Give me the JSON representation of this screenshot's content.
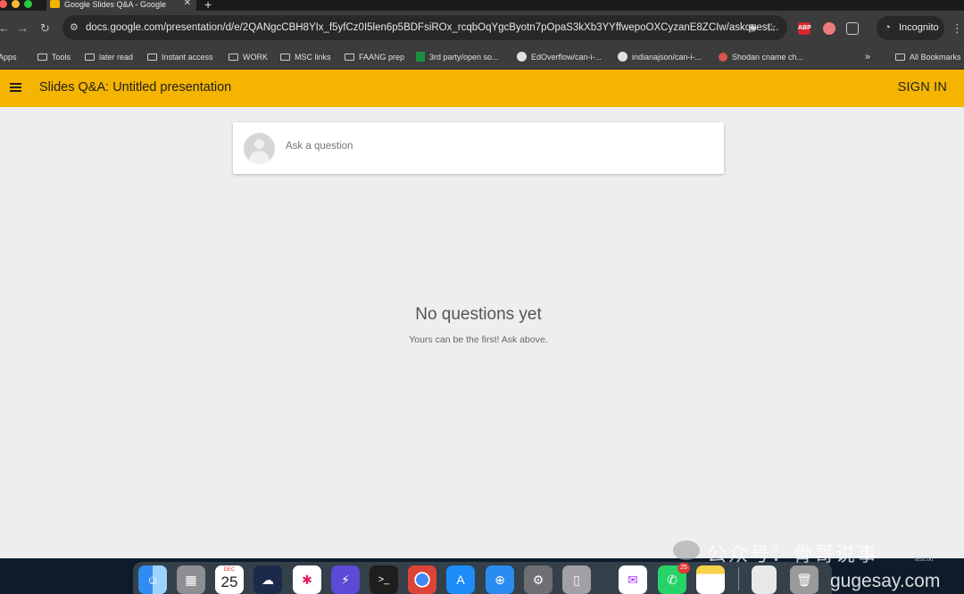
{
  "browser": {
    "tab_title": "Google Slides Q&A - Google",
    "tab_close": "✕",
    "new_tab": "+",
    "url": "docs.google.com/presentation/d/e/2QANgcCBH8YIx_f5yfCz0I5len6p5BDFsiROx_rcqbOqYgcByotn7pOpaS3kXb3YYffwepoOXCyzanE8ZCIw/askquest...",
    "incognito_label": "Incognito",
    "extensions": [
      "ABP",
      "extension-icon",
      "puzzle-icon"
    ]
  },
  "bookmarks": [
    {
      "label": "Apps",
      "icon": "grid-icon"
    },
    {
      "label": "Tools",
      "icon": "folder-icon"
    },
    {
      "label": "later read",
      "icon": "folder-icon"
    },
    {
      "label": "Instant access",
      "icon": "folder-icon"
    },
    {
      "label": "WORK",
      "icon": "folder-icon"
    },
    {
      "label": "MSC links",
      "icon": "folder-icon"
    },
    {
      "label": "FAANG prep",
      "icon": "folder-icon"
    },
    {
      "label": "3rd party/open so...",
      "icon": "sheets-icon"
    },
    {
      "label": "EdOverflow/can-i-...",
      "icon": "github-icon"
    },
    {
      "label": "indianajson/can-i-...",
      "icon": "github-icon"
    },
    {
      "label": "Shodan cname ch...",
      "icon": "shodan-icon"
    },
    {
      "label": "»",
      "icon": "overflow-icon"
    },
    {
      "label": "All Bookmarks",
      "icon": "folder-icon"
    }
  ],
  "app": {
    "title": "Slides Q&A: Untitled presentation",
    "sign_in": "SIGN IN",
    "accent": "#f4b400"
  },
  "ask": {
    "placeholder": "Ask a question"
  },
  "empty_state": {
    "title": "No questions yet",
    "subtitle": "Yours can be the first! Ask above."
  },
  "dock": {
    "calendar_month": "DEC",
    "calendar_day": "25",
    "whatsapp_badge": "25",
    "file_label": "test.txt"
  },
  "watermark": {
    "text": "公众号：骨哥说事",
    "site": "gugesay.com"
  }
}
